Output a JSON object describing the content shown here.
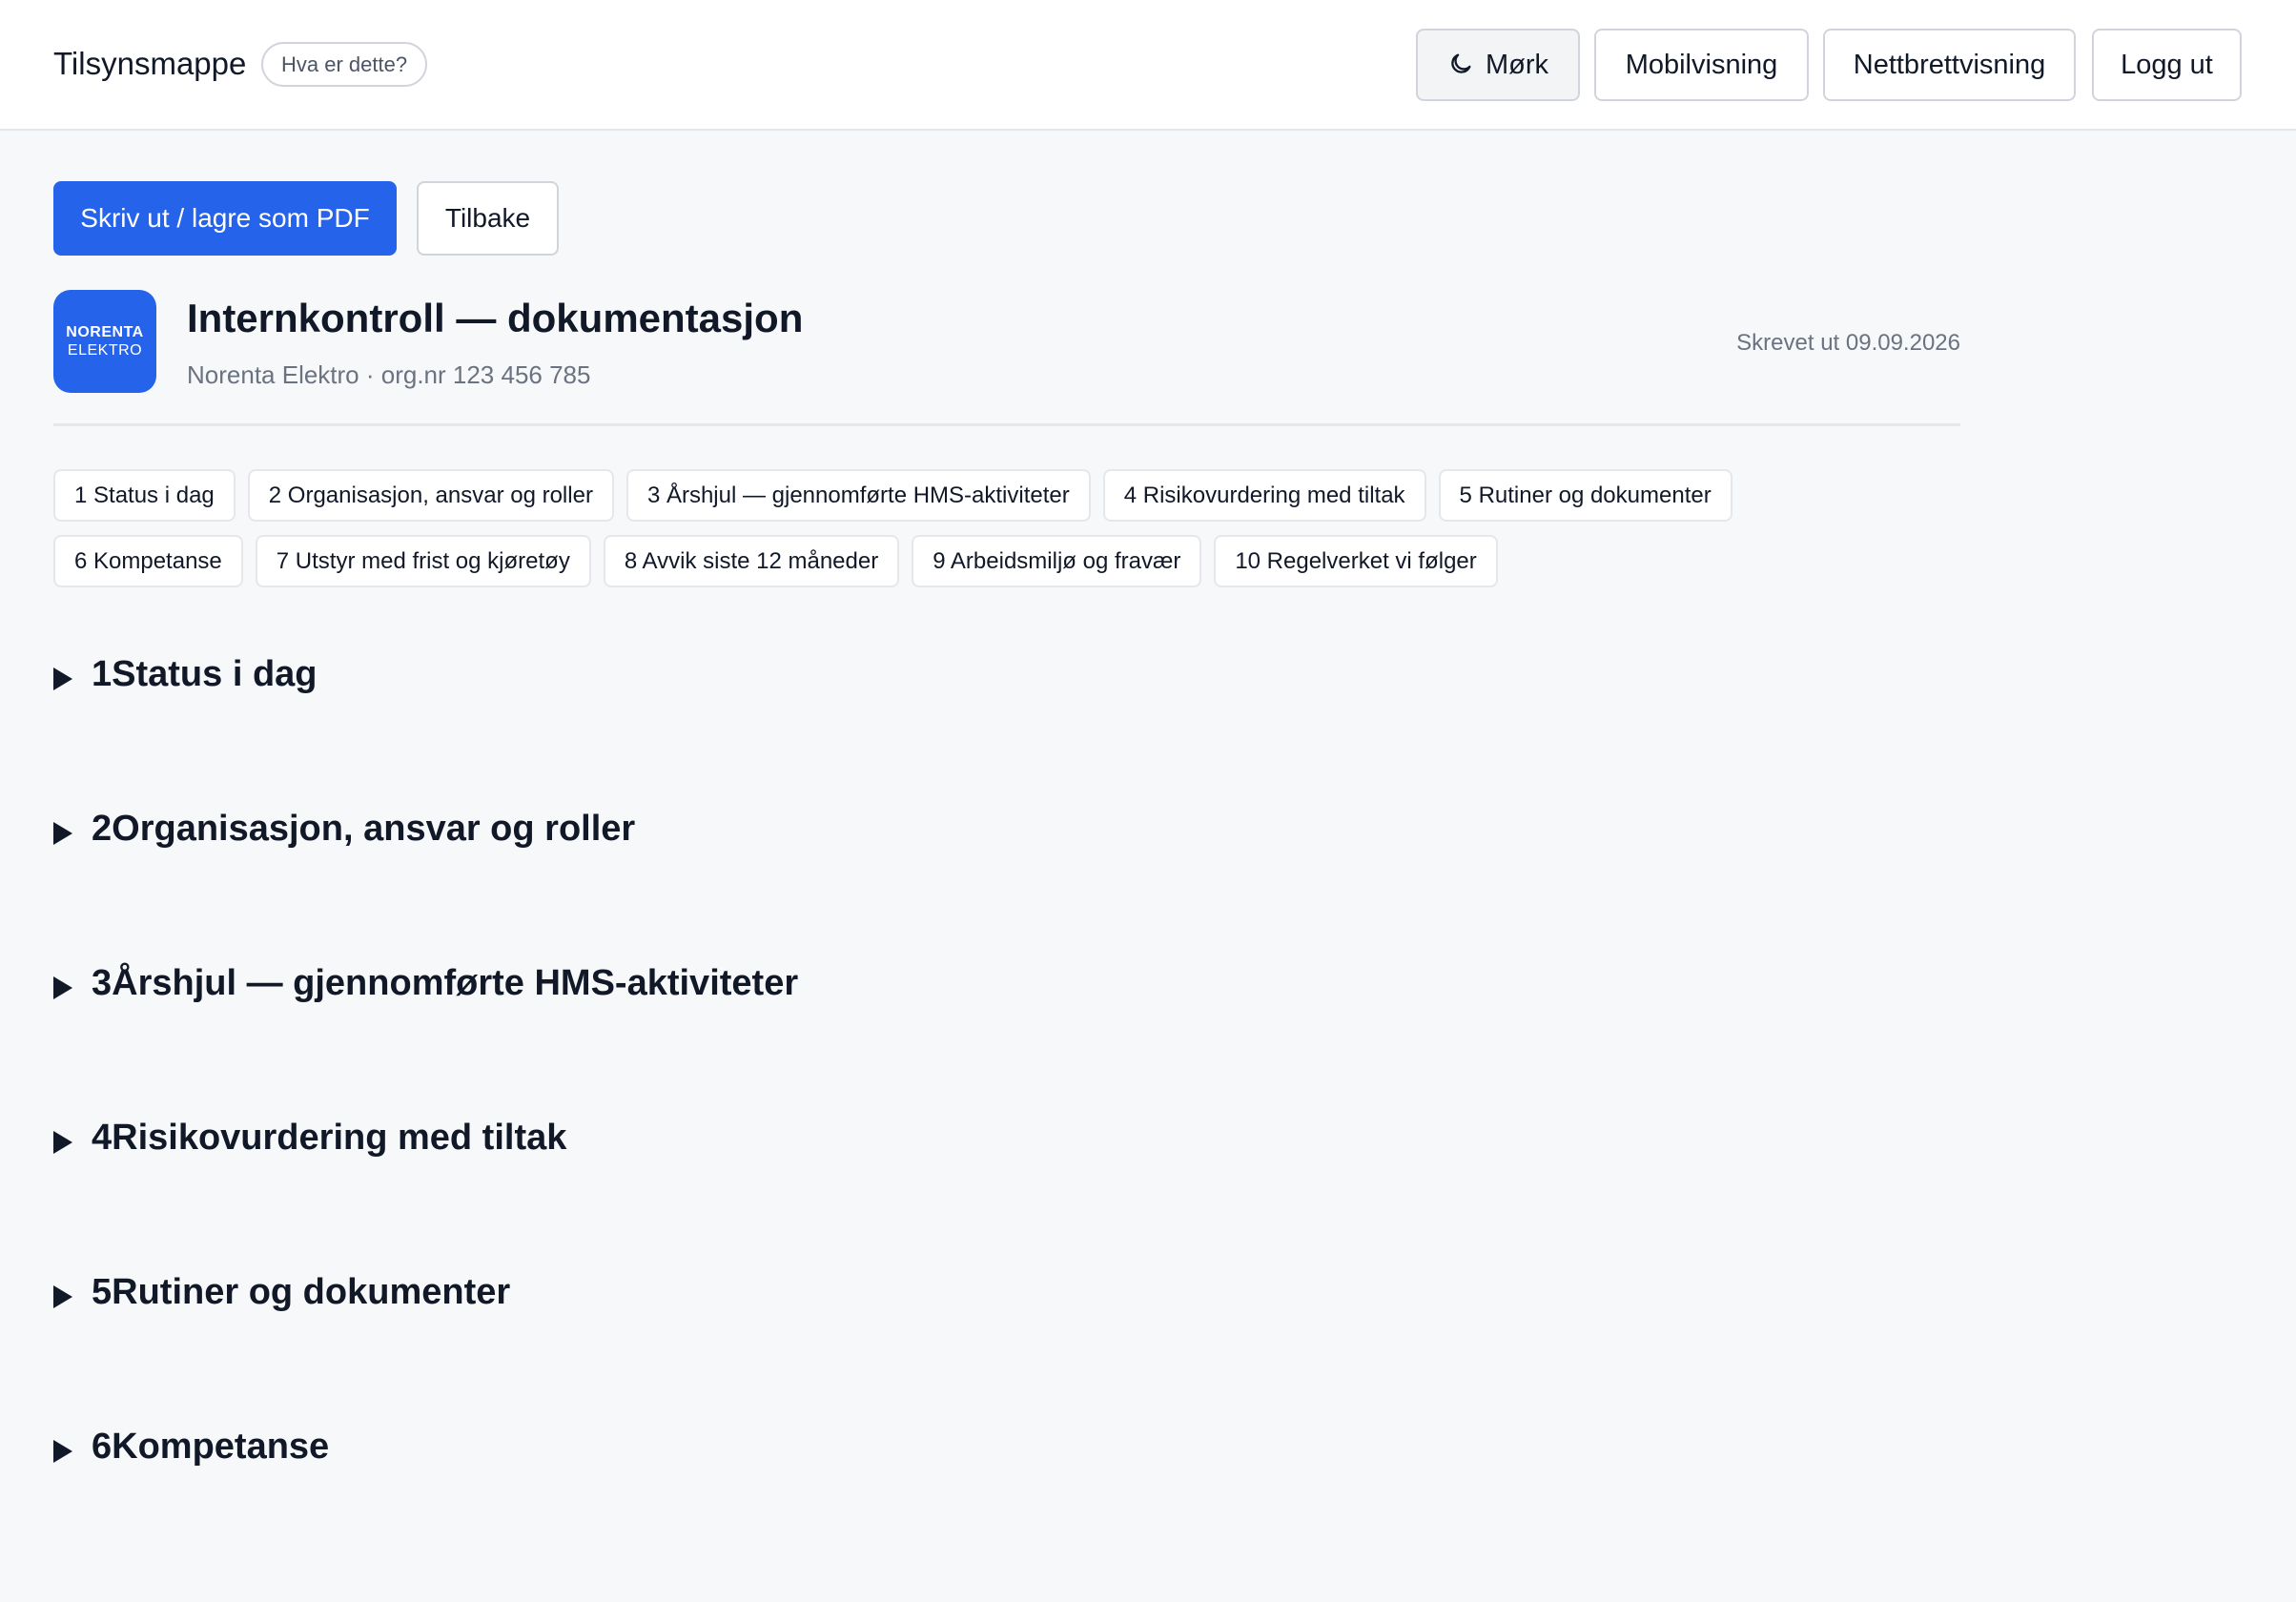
{
  "header": {
    "brand": "Tilsynsmappe",
    "help": "Hva er dette?",
    "dark_label": "Mørk",
    "mobile_label": "Mobilvisning",
    "tablet_label": "Nettbrettvisning",
    "logout_label": "Logg ut"
  },
  "actions": {
    "print_label": "Skriv ut / lagre som PDF",
    "back_label": "Tilbake"
  },
  "document": {
    "logo_line1": "NORENTA",
    "logo_line2": "ELEKTRO",
    "title": "Internkontroll — dokumentasjon",
    "subtitle": "Norenta Elektro · org.nr 123 456 785",
    "printed": "Skrevet ut 09.09.2026"
  },
  "chips": [
    "1 Status i dag",
    "2 Organisasjon, ansvar og roller",
    "3 Årshjul — gjennomførte HMS-aktiviteter",
    "4 Risikovurdering med tiltak",
    "5 Rutiner og dokumenter",
    "6 Kompetanse",
    "7 Utstyr med frist og kjøretøy",
    "8 Avvik siste 12 måneder",
    "9 Arbeidsmiljø og fravær",
    "10 Regelverket vi følger"
  ],
  "sections": [
    "1Status i dag",
    "2Organisasjon, ansvar og roller",
    "3Årshjul — gjennomførte HMS-aktiviteter",
    "4Risikovurdering med tiltak",
    "5Rutiner og dokumenter",
    "6Kompetanse"
  ],
  "colors": {
    "accent": "#2563eb",
    "background": "#f6f8fa"
  }
}
